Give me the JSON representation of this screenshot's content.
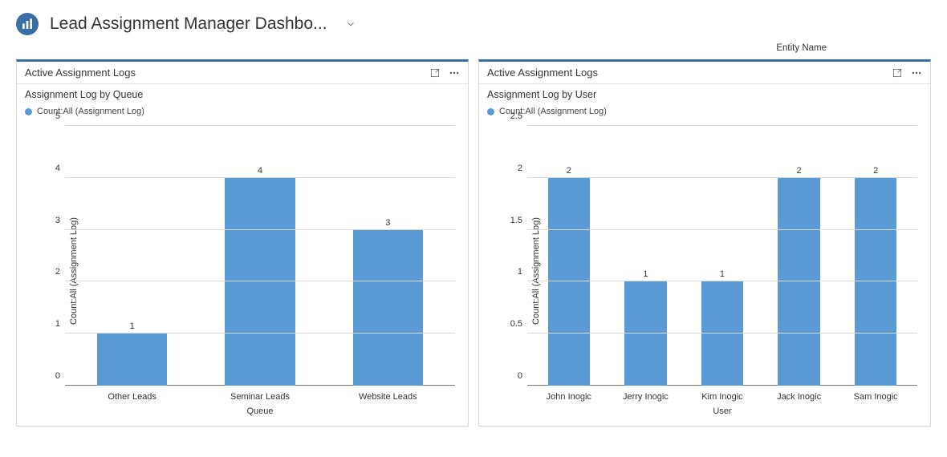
{
  "header": {
    "title": "Lead Assignment Manager Dashbo..."
  },
  "entity_label": "Entity Name",
  "panels": [
    {
      "title": "Active Assignment Logs",
      "subtitle": "Assignment Log by Queue",
      "legend": "Count:All (Assignment Log)",
      "y_label": "Count:All (Assignment Log)",
      "x_label": "Queue"
    },
    {
      "title": "Active Assignment Logs",
      "subtitle": "Assignment Log by User",
      "legend": "Count:All (Assignment Log)",
      "y_label": "Count:All (Assignment Log)",
      "x_label": "User"
    }
  ],
  "chart_data": [
    {
      "type": "bar",
      "title": "Assignment Log by Queue",
      "xlabel": "Queue",
      "ylabel": "Count:All (Assignment Log)",
      "ylim": [
        0,
        5
      ],
      "y_ticks": [
        0,
        1,
        2,
        3,
        4,
        5
      ],
      "legend": [
        "Count:All (Assignment Log)"
      ],
      "categories": [
        "Other Leads",
        "Seminar Leads",
        "Website Leads"
      ],
      "values": [
        1,
        4,
        3
      ]
    },
    {
      "type": "bar",
      "title": "Assignment Log by User",
      "xlabel": "User",
      "ylabel": "Count:All (Assignment Log)",
      "ylim": [
        0,
        2.5
      ],
      "y_ticks": [
        0,
        0.5,
        1,
        1.5,
        2,
        2.5
      ],
      "legend": [
        "Count:All (Assignment Log)"
      ],
      "categories": [
        "John Inogic",
        "Jerry Inogic",
        "Kim Inogic",
        "Jack Inogic",
        "Sam Inogic"
      ],
      "values": [
        2,
        1,
        1,
        2,
        2
      ]
    }
  ]
}
